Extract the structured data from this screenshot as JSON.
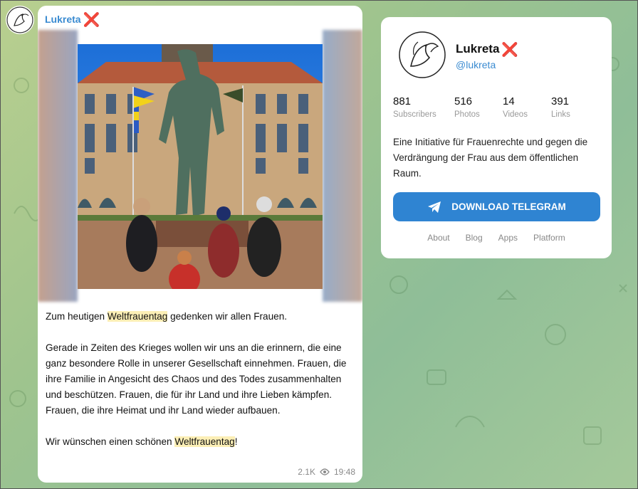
{
  "post": {
    "author": "Lukreta",
    "author_mark": "❌",
    "paragraphs": [
      {
        "before": "Zum heutigen ",
        "highlight": "Weltfrauentag",
        "after": " gedenken wir allen Frauen."
      },
      {
        "text": "Gerade in Zeiten des Krieges wollen wir uns an die erinnern, die eine ganz besondere Rolle in unserer Gesellschaft einnehmen. Frauen, die ihre Familie in Angesicht des Chaos und des Todes zusammenhalten und beschützen. Frauen, die für ihr Land und ihre Lieben kämpfen. Frauen, die ihre Heimat und ihr Land wieder aufbauen."
      },
      {
        "before": "Wir wünschen einen schönen ",
        "highlight": "Weltfrauentag",
        "after": "!"
      }
    ],
    "views": "2.1K",
    "time": "19:48"
  },
  "channel": {
    "name": "Lukreta",
    "name_mark": "❌",
    "handle": "@lukreta",
    "stats": [
      {
        "value": "881",
        "label": "Subscribers"
      },
      {
        "value": "516",
        "label": "Photos"
      },
      {
        "value": "14",
        "label": "Videos"
      },
      {
        "value": "391",
        "label": "Links"
      }
    ],
    "description": "Eine Initiative für Frauenrechte und gegen die Verdrängung der Frau aus dem öffentlichen Raum.",
    "download_label": "DOWNLOAD TELEGRAM",
    "links": [
      "About",
      "Blog",
      "Apps",
      "Platform"
    ]
  },
  "colors": {
    "accent": "#2f84d2",
    "link": "#3a8bd1",
    "highlight": "#fcefb6",
    "x_mark": "#e01e22"
  }
}
